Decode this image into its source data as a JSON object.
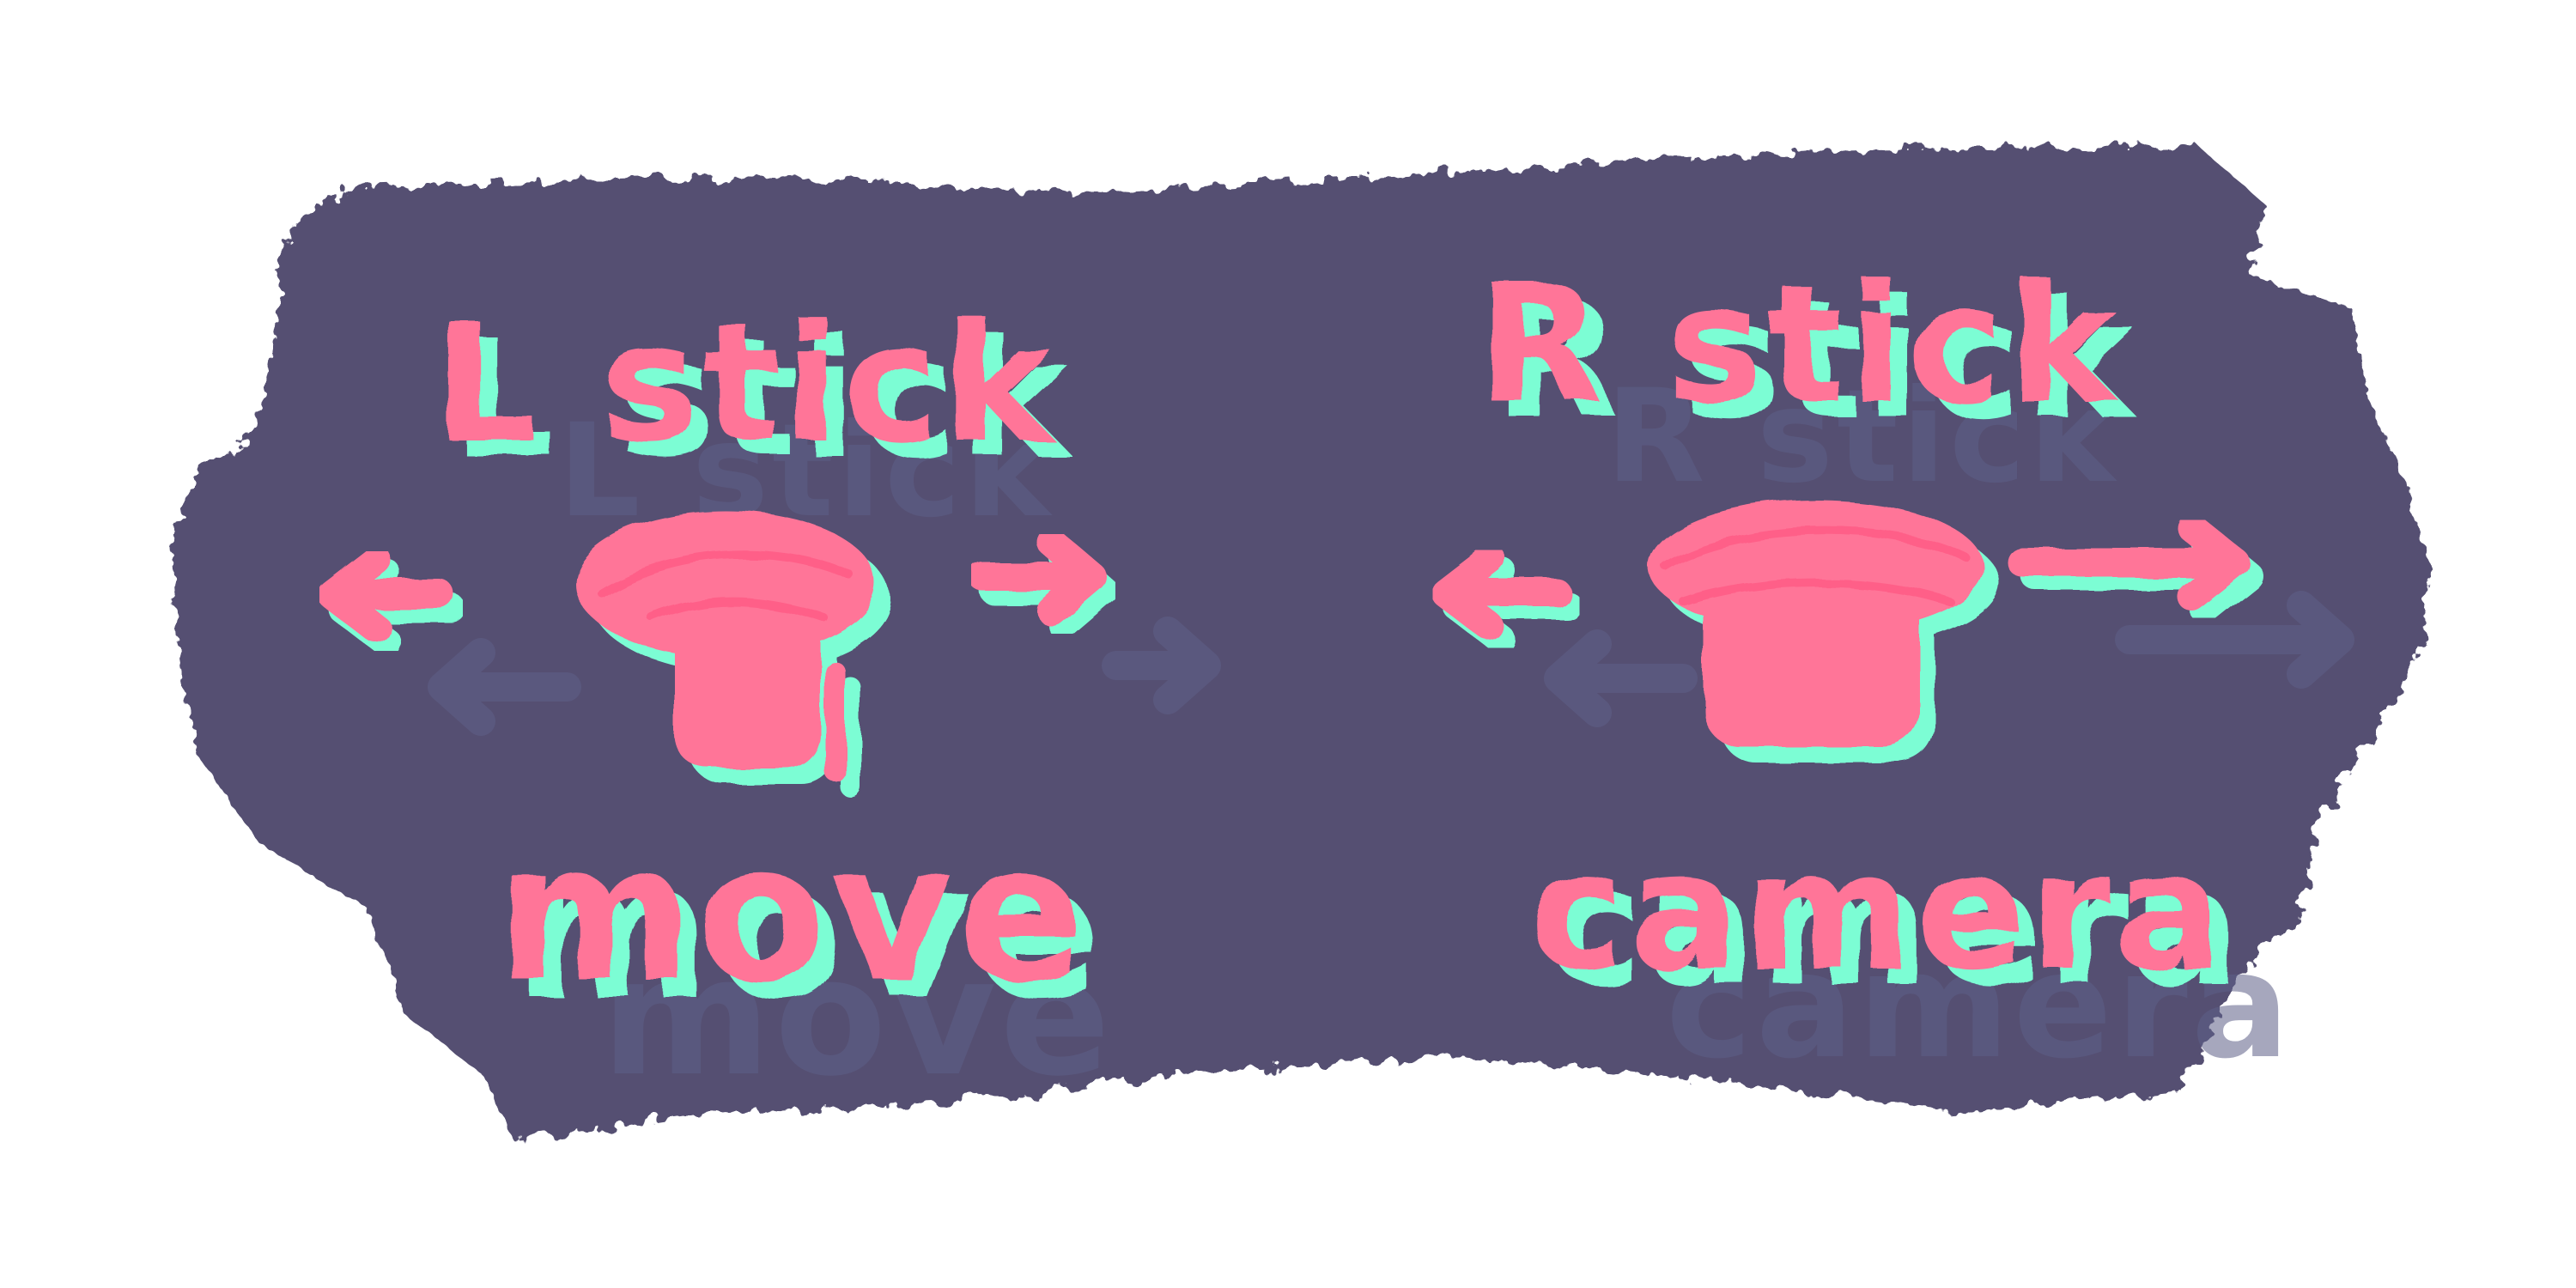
{
  "colors": {
    "background": "#ffffff",
    "panel": "#545072",
    "panel_edge": "#5e5a80",
    "ghost": "#5e6088",
    "pink": "#ff7598",
    "mint": "#7cfdd4"
  },
  "controls": [
    {
      "stick_label": "L stick",
      "action_label": "move",
      "icon": "analog-stick-icon",
      "arrows": [
        "arrow-left-icon",
        "arrow-right-icon"
      ]
    },
    {
      "stick_label": "R stick",
      "action_label": "camera",
      "icon": "analog-stick-icon",
      "arrows": [
        "arrow-left-icon",
        "arrow-right-icon"
      ]
    }
  ]
}
